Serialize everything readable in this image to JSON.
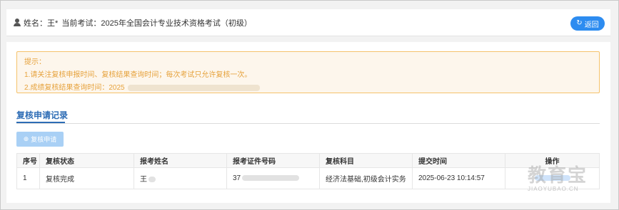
{
  "header": {
    "name_label": "姓名：王*",
    "exam_label": "当前考试：2025年全国会计专业技术资格考试（初级）",
    "back_label": "返回"
  },
  "notice": {
    "title": "提示：",
    "line1": "1.请关注复核申报时间、复核结果查询时间；每次考试只允许复核一次。",
    "line2_prefix": "2.成绩复核结果查询时间：2025"
  },
  "tab": {
    "label": "复核申请记录"
  },
  "apply_button": {
    "label": "复核申请",
    "icon": "plus-circle-icon"
  },
  "table": {
    "headers": [
      "序号",
      "复核状态",
      "报考姓名",
      "报考证件号码",
      "复核科目",
      "提交时间",
      "操作"
    ],
    "rows": [
      {
        "index": "1",
        "status": "复核完成",
        "name": "王",
        "id": "37",
        "subjects": "经济法基础,初级会计实务",
        "time": "2025-06-23 10:14:57"
      }
    ]
  },
  "watermark": {
    "cn": "教育宝",
    "en": "JIAOYUBAO.CN"
  },
  "colors": {
    "accent": "#2d8cf0",
    "notice_text": "#e6a23c",
    "notice_bg": "#fdf6ec",
    "tab": "#2d6cb5"
  }
}
